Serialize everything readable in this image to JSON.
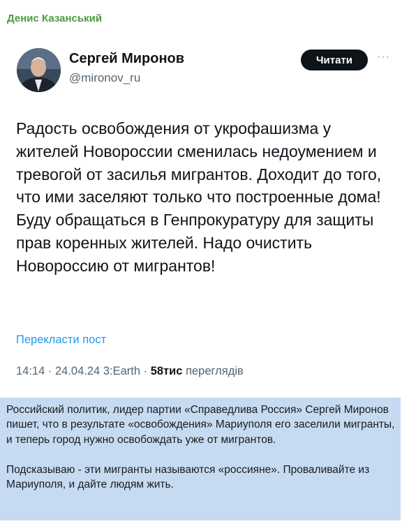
{
  "forward": {
    "author": "Денис Казанський"
  },
  "tweet": {
    "display_name": "Сергей Миронов",
    "handle": "@mironov_ru",
    "follow_label": "Читати",
    "more_icon": "more-horizontal-icon",
    "text": "Радость освобождения от укрофашизма у жителей Новороссии сменилась недоумением и тревогой от засилья мигрантов. Доходит до того, что ими заселяют только что построенные дома! Буду обращаться в Генпрокуратуру для защиты прав коренных жителей. Надо очистить Новороссию от мигрантов!",
    "translate_label": "Перекласти пост",
    "time": "14:14",
    "date": "24.04.24",
    "source": "3:Earth",
    "views_count": "58тис",
    "views_label": "переглядів"
  },
  "comment": {
    "paragraph1": "Российский политик, лидер партии «Справедлива Россия» Сергей Миронов пишет, что в результате «освобождения» Мариуполя его заселили мигранты, и теперь город нужно освобождать уже от мигрантов.",
    "paragraph2": "Подсказываю - эти мигранты называются «россияне». Проваливайте из Мариуполя, и дайте людям жить."
  },
  "colors": {
    "author_green": "#4a9b3d",
    "link_blue": "#1d9bf0",
    "comment_bg": "#c6daf2",
    "button_bg": "#0f1419"
  }
}
